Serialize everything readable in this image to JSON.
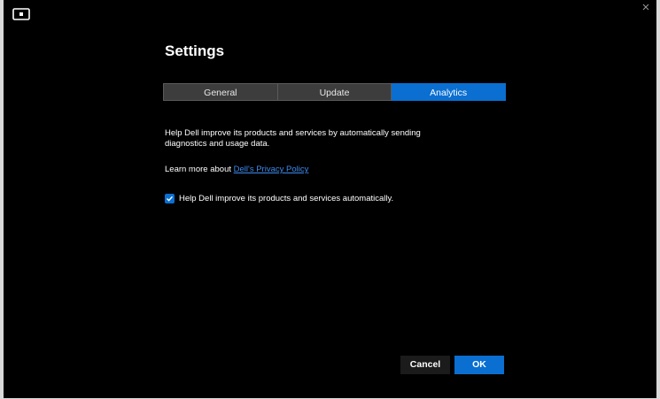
{
  "window": {
    "title": "Settings",
    "app_icon": "monitor-icon",
    "close_icon": "close-icon"
  },
  "tabs": [
    {
      "label": "General",
      "active": false
    },
    {
      "label": "Update",
      "active": false
    },
    {
      "label": "Analytics",
      "active": true
    }
  ],
  "analytics": {
    "description": "Help Dell improve its products and services by automatically sending diagnostics and usage data.",
    "learn_more_prefix": "Learn more about",
    "privacy_link": "Dell's Privacy Policy",
    "consent_label": "Help Dell improve its products and services automatically.",
    "consent_checked": true
  },
  "buttons": {
    "cancel": "Cancel",
    "ok": "OK"
  },
  "colors": {
    "accent": "#0a6fd1",
    "link": "#3d8bef",
    "background": "#000000",
    "tab_inactive": "#3d3d3d"
  }
}
